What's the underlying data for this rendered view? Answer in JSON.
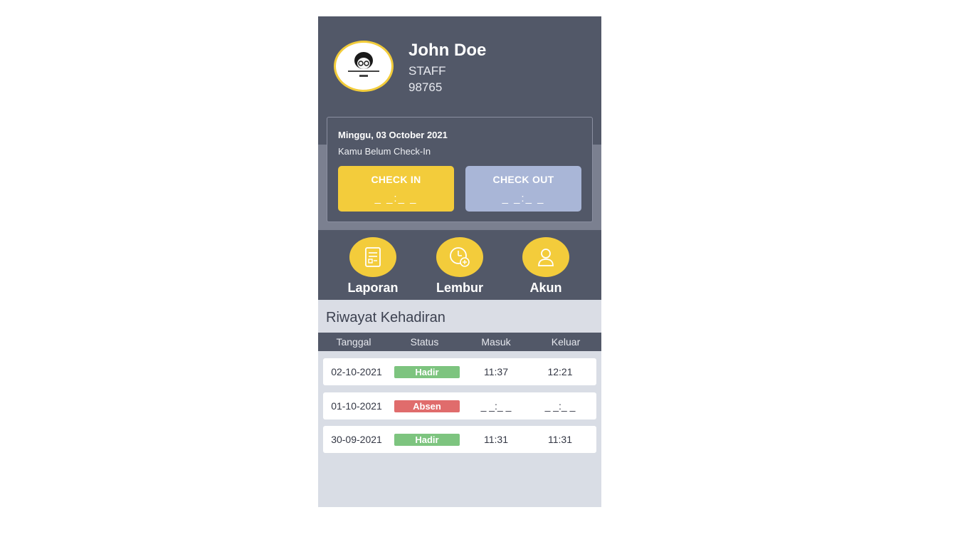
{
  "profile": {
    "name": "John Doe",
    "role": "STAFF",
    "employee_id": "98765",
    "avatar_icon": "person-avatar-icon",
    "avatar_border_color": "#f2cc3a"
  },
  "attendance_card": {
    "date": "Minggu, 03 October 2021",
    "status": "Kamu Belum Check-In",
    "check_in": {
      "label": "CHECK IN",
      "time": "_ _:_ _",
      "color": "#f3cc3b"
    },
    "check_out": {
      "label": "CHECK OUT",
      "time": "_ _:_ _",
      "color": "#a9b6d7"
    }
  },
  "menu": [
    {
      "label": "Laporan",
      "icon": "report-document-icon"
    },
    {
      "label": "Lembur",
      "icon": "clock-add-icon"
    },
    {
      "label": "Akun",
      "icon": "user-account-icon"
    }
  ],
  "history": {
    "title": "Riwayat Kehadiran",
    "columns": [
      "Tanggal",
      "Status",
      "Masuk",
      "Keluar"
    ],
    "rows": [
      {
        "date": "02-10-2021",
        "status": "Hadir",
        "status_color": "#7dc47f",
        "in": "11:37",
        "out": "12:21"
      },
      {
        "date": "01-10-2021",
        "status": "Absen",
        "status_color": "#e06c6c",
        "in": "_ _:_ _",
        "out": "_ _:_ _"
      },
      {
        "date": "30-09-2021",
        "status": "Hadir",
        "status_color": "#7dc47f",
        "in": "11:31",
        "out": "11:31"
      }
    ]
  }
}
